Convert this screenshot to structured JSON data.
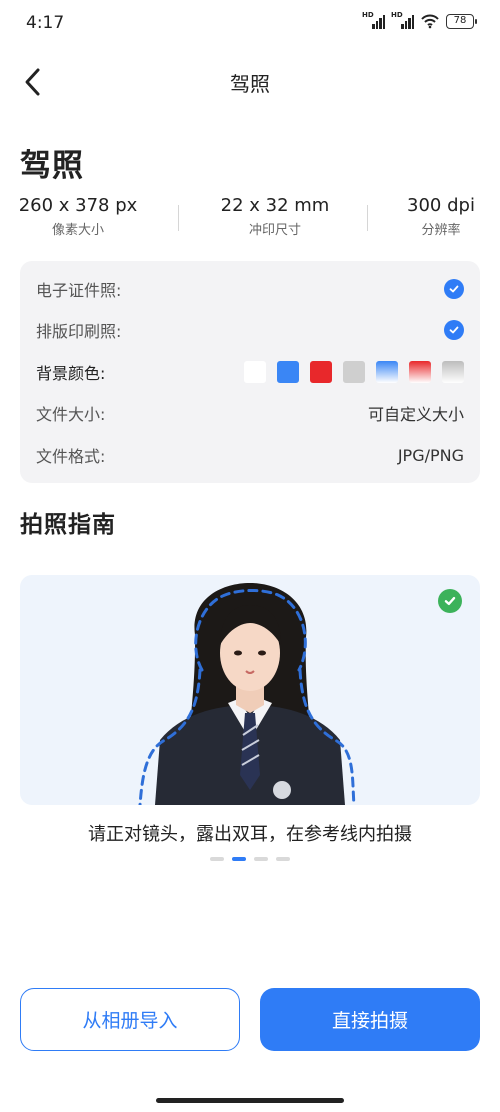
{
  "status_bar": {
    "time": "4:17",
    "signal_hd_label": "HD",
    "battery": "78"
  },
  "nav": {
    "title": "驾照",
    "back_icon": "chevron-left-icon"
  },
  "page_title": "驾照",
  "specs": [
    {
      "value": "260 x 378 px",
      "label": "像素大小"
    },
    {
      "value": "22 x 32 mm",
      "label": "冲印尺寸"
    },
    {
      "value": "300 dpi",
      "label": "分辨率"
    }
  ],
  "info": {
    "e_photo_label": "电子证件照:",
    "print_photo_label": "排版印刷照:",
    "bg_color_label": "背景颜色:",
    "file_size_label": "文件大小:",
    "file_size_value": "可自定义大小",
    "file_format_label": "文件格式:",
    "file_format_value": "JPG/PNG",
    "bg_colors": [
      "#ffffff",
      "#3a86f5",
      "#e8282b",
      "#cfcfcf",
      "gradient-blue",
      "gradient-red",
      "gradient-gray"
    ]
  },
  "guide": {
    "section_title": "拍照指南",
    "caption": "请正对镜头，露出双耳，在参考线内拍摄",
    "slide_count": 4,
    "active_slide": 1
  },
  "buttons": {
    "album": "从相册导入",
    "shoot": "直接拍摄"
  },
  "colors": {
    "accent": "#2f7cf6",
    "success": "#3cb25a",
    "card_bg": "#f3f3f5",
    "guide_bg": "#eef4fc"
  }
}
